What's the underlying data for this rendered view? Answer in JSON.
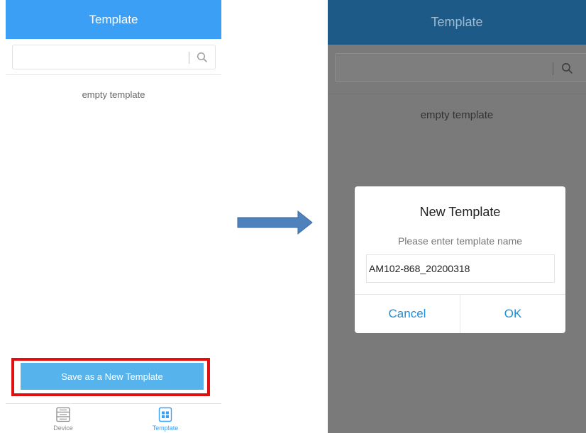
{
  "left_screen": {
    "header_title": "Template",
    "search": {
      "placeholder": "",
      "icon": "search-icon"
    },
    "empty_text": "empty template",
    "save_button_label": "Save as a  New Template",
    "tabs": [
      {
        "label": "Device",
        "icon": "device-list-icon",
        "active": false
      },
      {
        "label": "Template",
        "icon": "template-grid-icon",
        "active": true
      }
    ]
  },
  "right_screen": {
    "header_title": "Template",
    "search": {
      "placeholder": "",
      "icon": "search-icon"
    },
    "empty_text": "empty template",
    "dialog": {
      "title": "New Template",
      "subtitle": "Please enter template name",
      "input_value": "AM102-868_20200318",
      "cancel_label": "Cancel",
      "ok_label": "OK"
    }
  },
  "annotations": {
    "highlight_color": "#e01010",
    "arrow_color": "#4f81bd"
  },
  "colors": {
    "header_blue": "#3a9ff5",
    "dimmed_header": "#1e5a87",
    "button_blue": "#56b3ec",
    "dialog_button_text": "#1e8fd8",
    "overlay": "#7a7a7a"
  }
}
